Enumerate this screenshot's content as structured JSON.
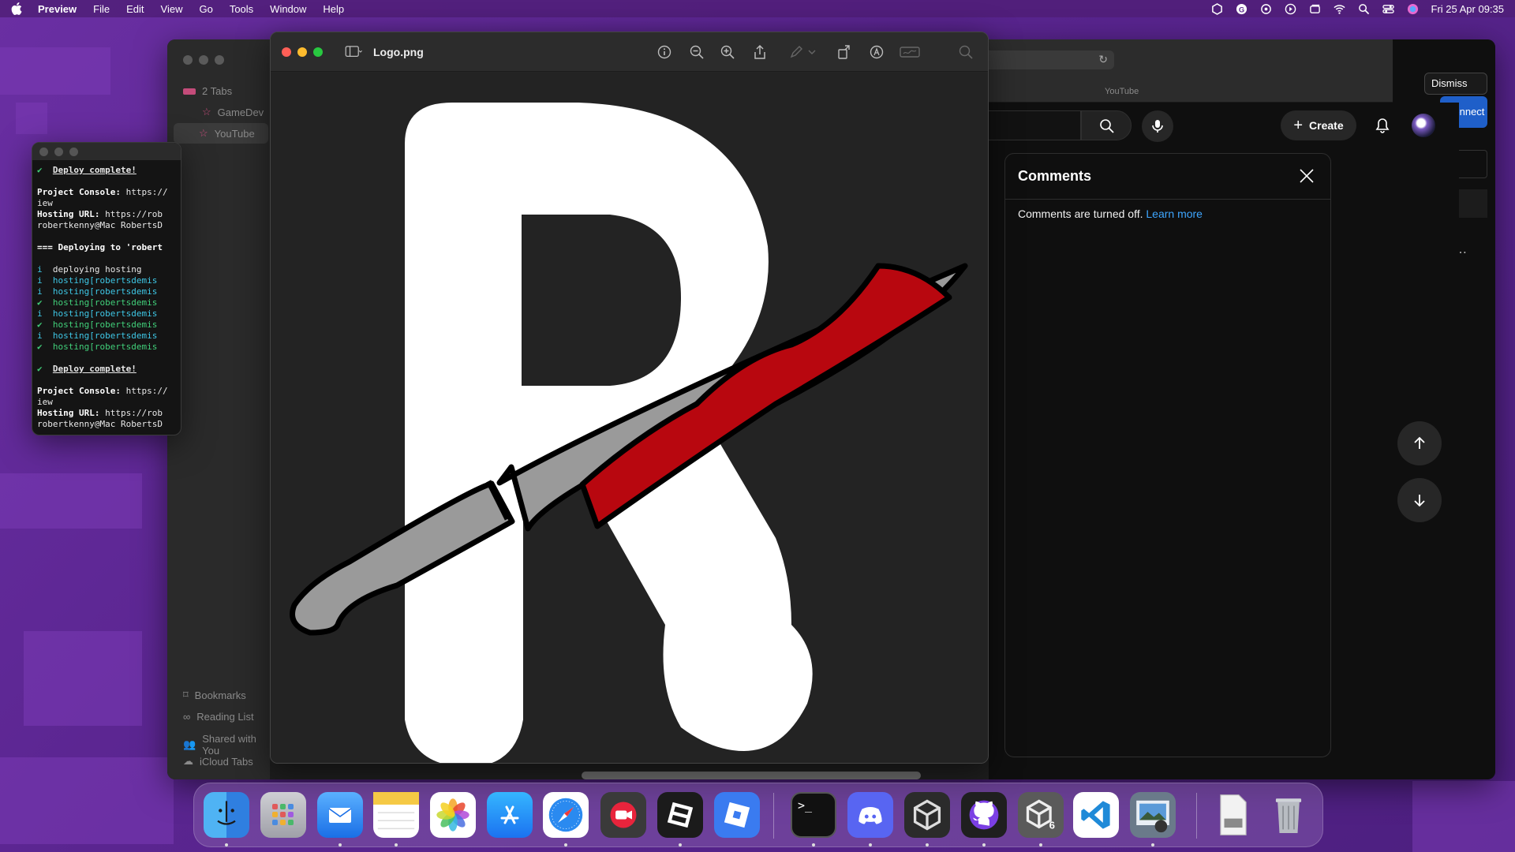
{
  "menubar": {
    "app": "Preview",
    "items": [
      "File",
      "Edit",
      "View",
      "Go",
      "Tools",
      "Window",
      "Help"
    ],
    "clock": "Fri 25 Apr  09:35"
  },
  "safari": {
    "tabs_label": "2 Tabs",
    "tab1": "GameDev",
    "tab2": "YouTube",
    "tab_strip_label": "YouTube",
    "sidebar_bottom": [
      "Bookmarks",
      "Reading List",
      "Shared with You",
      "iCloud Tabs"
    ],
    "dismiss": "Dismiss",
    "connect": "Connect"
  },
  "terminal": {
    "lines": [
      {
        "t": "✔  ",
        "c": "g",
        "rest": "Deploy complete!",
        "rc": "u"
      },
      {
        "t": "",
        "c": "",
        "rest": "",
        "rc": ""
      },
      {
        "t": "Project Console: ",
        "c": "w",
        "rest": "https://",
        "rc": ""
      },
      {
        "t": "iew",
        "c": "",
        "rest": "",
        "rc": ""
      },
      {
        "t": "Hosting URL: ",
        "c": "w",
        "rest": "https://rob",
        "rc": ""
      },
      {
        "t": "robertkenny@Mac RobertsD",
        "c": "",
        "rest": "",
        "rc": ""
      },
      {
        "t": "",
        "c": "",
        "rest": "",
        "rc": ""
      },
      {
        "t": "=== Deploying to 'robert",
        "c": "w",
        "rest": "",
        "rc": ""
      },
      {
        "t": "",
        "c": "",
        "rest": "",
        "rc": ""
      },
      {
        "t": "i  ",
        "c": "b",
        "rest": "deploying hosting",
        "rc": ""
      },
      {
        "t": "i  ",
        "c": "b",
        "rest": "hosting[robertsdemis",
        "rc": "b"
      },
      {
        "t": "i  ",
        "c": "b",
        "rest": "hosting[robertsdemis",
        "rc": "b"
      },
      {
        "t": "✔  ",
        "c": "g",
        "rest": "hosting[robertsdemis",
        "rc": "g"
      },
      {
        "t": "i  ",
        "c": "b",
        "rest": "hosting[robertsdemis",
        "rc": "b"
      },
      {
        "t": "✔  ",
        "c": "g",
        "rest": "hosting[robertsdemis",
        "rc": "g"
      },
      {
        "t": "i  ",
        "c": "b",
        "rest": "hosting[robertsdemis",
        "rc": "b"
      },
      {
        "t": "✔  ",
        "c": "g",
        "rest": "hosting[robertsdemis",
        "rc": "g"
      },
      {
        "t": "",
        "c": "",
        "rest": "",
        "rc": ""
      },
      {
        "t": "✔  ",
        "c": "g",
        "rest": "Deploy complete!",
        "rc": "u"
      },
      {
        "t": "",
        "c": "",
        "rest": "",
        "rc": ""
      },
      {
        "t": "Project Console: ",
        "c": "w",
        "rest": "https://",
        "rc": ""
      },
      {
        "t": "iew",
        "c": "",
        "rest": "",
        "rc": ""
      },
      {
        "t": "Hosting URL: ",
        "c": "w",
        "rest": "https://rob",
        "rc": ""
      },
      {
        "t": "robertkenny@Mac RobertsD",
        "c": "",
        "rest": "",
        "rc": ""
      }
    ]
  },
  "preview": {
    "filename": "Logo.png"
  },
  "youtube": {
    "create_label": "Create",
    "comments_title": "Comments",
    "comments_message": "Comments are turned off.",
    "learn_more": "Learn more"
  },
  "dock": {
    "apps": [
      "Finder",
      "Launchpad",
      "Mail",
      "Notes",
      "Photos",
      "App Store",
      "Safari",
      "Video Recorder",
      "Roblox Studio",
      "Roblox",
      "Terminal",
      "Discord",
      "Unity Hub",
      "GitHub Desktop",
      "Unity 6",
      "Visual Studio Code",
      "Preview",
      "Downloads",
      "Trash"
    ]
  },
  "colors": {
    "wallpaper": "#5b2a8e",
    "youtube_link": "#3ea6ff",
    "terminal_green": "#41d07a",
    "terminal_blue": "#3ec7e6",
    "knife_blade": "#9a9a9a",
    "blood": "#b8070f"
  }
}
